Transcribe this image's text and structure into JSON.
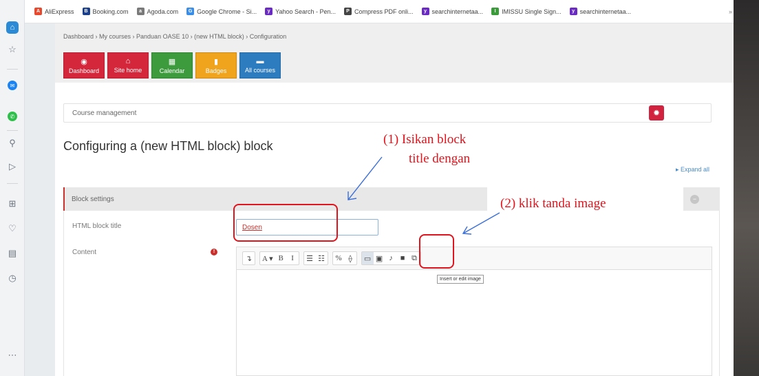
{
  "bookmarks": [
    {
      "label": "AliExpress",
      "color": "#e6492d",
      "glyph": "A"
    },
    {
      "label": "Booking.com",
      "color": "#1c3f8c",
      "glyph": "B"
    },
    {
      "label": "Agoda.com",
      "color": "#7a7a7a",
      "glyph": "a"
    },
    {
      "label": "Google Chrome - Si...",
      "color": "#3b8ee8",
      "glyph": "G"
    },
    {
      "label": "Yahoo Search - Pen...",
      "color": "#6a2bc2",
      "glyph": "y"
    },
    {
      "label": "Compress PDF onli...",
      "color": "#444444",
      "glyph": "P"
    },
    {
      "label": "searchinternetaa...",
      "color": "#6a2bc2",
      "glyph": "y"
    },
    {
      "label": "IMISSU Single Sign...",
      "color": "#3b9b3b",
      "glyph": "I"
    },
    {
      "label": "searchinternetaa...",
      "color": "#6a2bc2",
      "glyph": "y"
    }
  ],
  "bookmarks_overflow": "»",
  "breadcrumb": "Dashboard  › My courses  › Panduan OASE 10  › (new HTML block)  › Configuration",
  "nav": [
    {
      "label": "Dashboard",
      "icon": "dashboard-icon",
      "glyph": "◉",
      "color": "#d4273c"
    },
    {
      "label": "Site home",
      "icon": "home-icon",
      "glyph": "⌂",
      "color": "#d4273c"
    },
    {
      "label": "Calendar",
      "icon": "calendar-icon",
      "glyph": "▦",
      "color": "#3d9a3d"
    },
    {
      "label": "Badges",
      "icon": "badge-icon",
      "glyph": "▮",
      "color": "#f0a31c"
    },
    {
      "label": "All courses",
      "icon": "courses-icon",
      "glyph": "▬",
      "color": "#2e7cc0"
    }
  ],
  "course_management": "Course management",
  "heading": "Configuring a (new HTML block) block",
  "expand_all": "▸ Expand all",
  "block_settings": "Block settings",
  "fields": {
    "title_label": "HTML block title",
    "title_value": "Dosen",
    "content_label": "Content",
    "required_glyph": "!"
  },
  "toolbar_groups": [
    [
      {
        "glyph": "↴",
        "icon": "show-more-icon"
      }
    ],
    [
      {
        "glyph": "A ▾",
        "icon": "font-style-icon"
      },
      {
        "glyph": "B",
        "icon": "bold-icon"
      },
      {
        "glyph": "I",
        "icon": "italic-icon"
      }
    ],
    [
      {
        "glyph": "☰",
        "icon": "unordered-list-icon"
      },
      {
        "glyph": "☷",
        "icon": "ordered-list-icon"
      }
    ],
    [
      {
        "glyph": "%",
        "icon": "link-icon"
      },
      {
        "glyph": "⟠",
        "icon": "unlink-icon"
      }
    ],
    [
      {
        "glyph": "▭",
        "icon": "image-icon",
        "active": true
      },
      {
        "glyph": "▣",
        "icon": "media-icon"
      },
      {
        "glyph": "♪",
        "icon": "audio-icon"
      },
      {
        "glyph": "■",
        "icon": "video-icon"
      },
      {
        "glyph": "⧉",
        "icon": "manage-files-icon"
      }
    ]
  ],
  "tooltip": "Insert or edit image",
  "annotations": {
    "one_line1": "(1) Isikan block",
    "one_line2": "title dengan",
    "two_line1": "(2) klik   tanda   image"
  },
  "colors": {
    "annotation": "#e0141d",
    "arrow": "#3b6fd6"
  }
}
